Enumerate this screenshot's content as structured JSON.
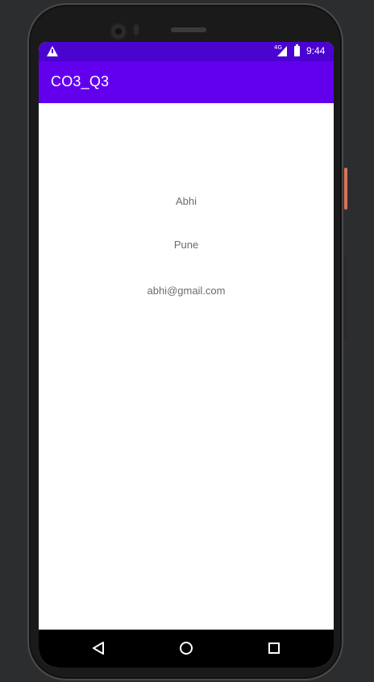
{
  "status_bar": {
    "time": "9:44",
    "network": "4G",
    "icons": [
      "warning-icon",
      "signal-icon",
      "battery-icon"
    ]
  },
  "app_bar": {
    "title": "CO3_Q3"
  },
  "content": {
    "name": "Abhi",
    "city": "Pune",
    "email": "abhi@gmail.com"
  },
  "nav_bar": {
    "icons": [
      "back-icon",
      "home-icon",
      "recents-icon"
    ]
  },
  "colors": {
    "status_bar": "#4b03d0",
    "app_bar": "#6200ee",
    "text": "#6b6b6b",
    "background": "#ffffff"
  }
}
